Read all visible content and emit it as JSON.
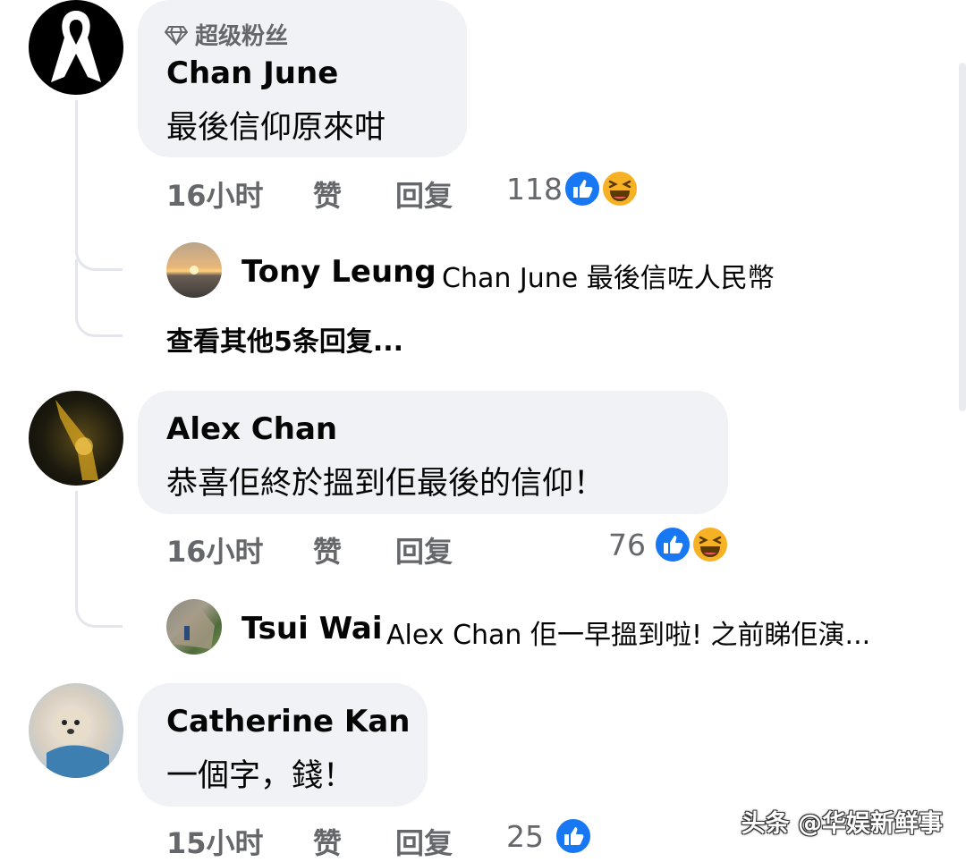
{
  "comments": [
    {
      "badge": "超级粉丝",
      "author": "Chan June",
      "text": "最後信仰原來咁",
      "time": "16小时",
      "like_label": "赞",
      "reply_label": "回复",
      "reaction_count": "118",
      "reactions": [
        "like-icon",
        "haha-icon"
      ],
      "replies": [
        {
          "author": "Tony Leung",
          "text": "Chan June 最後信咗人民幣"
        }
      ],
      "view_more": "查看其他5条回复..."
    },
    {
      "author": "Alex Chan",
      "text": "恭喜佢終於搵到佢最後的信仰！",
      "time": "16小时",
      "like_label": "赞",
      "reply_label": "回复",
      "reaction_count": "76",
      "reactions": [
        "like-icon",
        "haha-icon"
      ],
      "replies": [
        {
          "author": "Tsui Wai",
          "text": "Alex Chan 佢一早搵到啦! 之前睇佢演..."
        }
      ]
    },
    {
      "author": "Catherine Kan",
      "text": "一個字，錢！",
      "time": "15小时",
      "like_label": "赞",
      "reply_label": "回复",
      "reaction_count": "25",
      "reactions": [
        "like-icon"
      ]
    }
  ],
  "watermark": "头条 @华娱新鲜事",
  "colors": {
    "like_blue": "#1877f2",
    "haha_yellow": "#f7b125",
    "bubble_bg": "#f0f2f5",
    "meta_gray": "#65676b"
  }
}
